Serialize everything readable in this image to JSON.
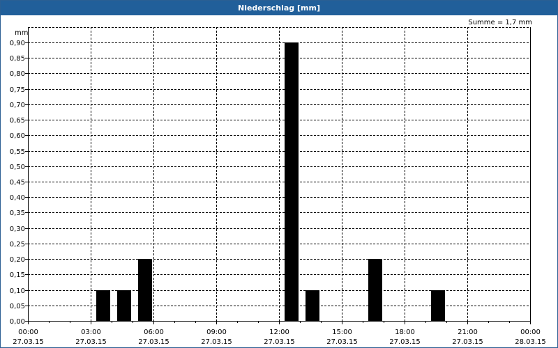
{
  "window": {
    "title": "Niederschlag [mm]"
  },
  "summary": "Summe = 1,7 mm",
  "colors": {
    "titlebar": "#215f9a",
    "bar": "#000000",
    "grid": "#000000"
  },
  "chart_data": {
    "type": "bar",
    "title": "Niederschlag [mm]",
    "ylabel": "mm",
    "xlabel": "",
    "ylim": [
      0,
      0.9
    ],
    "yticks": [
      "0,00",
      "0,05",
      "0,10",
      "0,15",
      "0,20",
      "0,25",
      "0,30",
      "0,35",
      "0,40",
      "0,45",
      "0,50",
      "0,55",
      "0,60",
      "0,65",
      "0,70",
      "0,75",
      "0,80",
      "0,85",
      "0,90"
    ],
    "xticks": [
      {
        "time": "00:00",
        "date": "27.03.15"
      },
      {
        "time": "03:00",
        "date": "27.03.15"
      },
      {
        "time": "06:00",
        "date": "27.03.15"
      },
      {
        "time": "09:00",
        "date": "27.03.15"
      },
      {
        "time": "12:00",
        "date": "27.03.15"
      },
      {
        "time": "15:00",
        "date": "27.03.15"
      },
      {
        "time": "18:00",
        "date": "27.03.15"
      },
      {
        "time": "21:00",
        "date": "27.03.15"
      },
      {
        "time": "00:00",
        "date": "28.03.15"
      }
    ],
    "xlim": [
      "27.03.15 00:00",
      "28.03.15 00:00"
    ],
    "bars": [
      {
        "time": "27.03.15 03:00",
        "value": 0.1
      },
      {
        "time": "27.03.15 04:00",
        "value": 0.1
      },
      {
        "time": "27.03.15 05:00",
        "value": 0.2
      },
      {
        "time": "27.03.15 12:00",
        "value": 0.9
      },
      {
        "time": "27.03.15 13:00",
        "value": 0.1
      },
      {
        "time": "27.03.15 16:00",
        "value": 0.2
      },
      {
        "time": "27.03.15 19:00",
        "value": 0.1
      }
    ],
    "grid": true
  }
}
